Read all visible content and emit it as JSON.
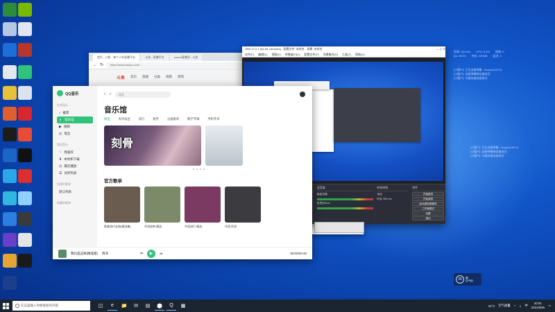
{
  "desktop": {
    "icons": 32
  },
  "browser": {
    "tabs": [
      "首页 - 斗鱼 - 每个人的直播平台",
      "斗鱼 - 直播平台",
      "cursor直播间 - 斗鱼",
      ""
    ],
    "url": "https://www.douyu.com/...",
    "site_logo": "斗鱼",
    "site_nav": [
      "首页",
      "直播",
      "分类",
      "视频",
      "游戏"
    ]
  },
  "qqmusic": {
    "app_name": "QQ音乐",
    "section_online": "在线音乐",
    "nav": [
      {
        "icon": "♪",
        "label": "推荐"
      },
      {
        "icon": "♬",
        "label": "音乐馆"
      },
      {
        "icon": "▶",
        "label": "视频"
      },
      {
        "icon": "◎",
        "label": "电台"
      }
    ],
    "section_mine": "我的音乐",
    "mine": [
      {
        "icon": "♡",
        "label": "我喜欢"
      },
      {
        "icon": "⬇",
        "label": "本地和下载"
      },
      {
        "icon": "◷",
        "label": "最近播放"
      },
      {
        "icon": "☰",
        "label": "试听列表"
      }
    ],
    "section_created": "创建的歌单",
    "created": [
      {
        "icon": "",
        "label": "默认列表"
      }
    ],
    "section_collected": "收藏的歌单",
    "search_placeholder": "搜索",
    "page_title": "音乐馆",
    "tabs": [
      "精选",
      "有声电台",
      "排行",
      "歌手",
      "分类歌单",
      "数字专辑",
      "手机专享"
    ],
    "banner_title": "刻骨",
    "banner_tag": "新歌",
    "playlist_heading": "官方歌单",
    "playlists": [
      {
        "name": "欧美流行金曲(精选集)",
        "color": "#6a5c4e"
      },
      {
        "name": "华语经典 精选",
        "color": "#7c8a6a"
      },
      {
        "name": "华语流行 精选",
        "color": "#7a3a62"
      },
      {
        "name": "华语 民谣",
        "color": "#3c3c40"
      }
    ],
    "player": {
      "song": "我们是这样(精选版)",
      "artist": "周深",
      "time": "00:00/03:46",
      "play_symbol": "▶"
    }
  },
  "obs": {
    "title": "OBS 27.0.1 (64-bit, windows) - 配置文件: 未命名 - 场景: 未命名",
    "menu": [
      "文件(F)",
      "编辑(E)",
      "视图(V)",
      "停靠窗口(D)",
      "配置文件(P)",
      "场景集合(S)",
      "工具(T)",
      "帮助(H)"
    ],
    "docks": {
      "scenes": {
        "header": "场景",
        "items": [
          "场景"
        ]
      },
      "sources": {
        "header": "来源",
        "items": [
          "视频捕获设备",
          "显示器采集",
          "窗口采集"
        ]
      },
      "mixer": {
        "header": "混音器",
        "channels": [
          "桌面音频",
          "麦克风/Aux"
        ]
      },
      "transitions": {
        "header": "转场特效",
        "mode": "淡出",
        "duration_label": "时长",
        "duration": "300 ms"
      },
      "controls": {
        "header": "控件",
        "buttons": [
          "开始推流",
          "开始录制",
          "启动虚拟摄像机",
          "工作室模式",
          "设置",
          "退出"
        ]
      }
    }
  },
  "overlay": {
    "stats1": [
      [
        "丢帧: 0(0.0%)",
        "CPU: 3.4%",
        "网络: 0"
      ],
      [
        "fps: 60.00",
        "内存: 220MB",
        "延迟: 0"
      ]
    ],
    "chat1": [
      "[小窗户]: 正在连接弹幕...Douyu(14974)",
      "[小窗户]: 连接弹幕服务器成功",
      "[小窗户]: 与服务器连接成功"
    ],
    "chat2": [
      "[小窗户]: 正在连接弹幕...Douyu(14974)",
      "[小窗户]: 连接弹幕服务器成功",
      "[小窗户]: 与服务器连接成功"
    ]
  },
  "taskbar": {
    "search_placeholder": "在这里输入你要搜索的内容",
    "apps": [
      "◫",
      "e",
      "📁",
      "✉",
      "▤",
      "⬤",
      "Q",
      "▦"
    ],
    "weather": "31°C",
    "weather_text": "空气质量",
    "ime": "中",
    "time": "20:01",
    "date": "2021/6/26"
  },
  "weather_widget": {
    "num": "29",
    "line1": "晴",
    "line2": "空气优"
  }
}
